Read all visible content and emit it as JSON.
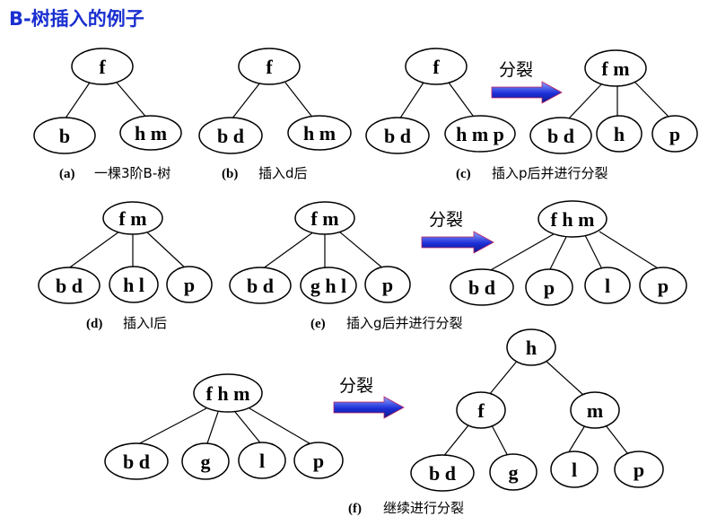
{
  "title": "B-树插入的例子",
  "arrow_label": "分裂",
  "colors": {
    "title": "#1a2fd0",
    "arrow_top": "#8fa0ff",
    "arrow_bottom": "#1c2fd6",
    "arrow_edge": "#c02060"
  },
  "captions": {
    "a": {
      "tag": "(a)",
      "text": "一棵3阶B-树"
    },
    "b": {
      "tag": "(b)",
      "text": "插入d后"
    },
    "c": {
      "tag": "(c)",
      "text": "插入p后并进行分裂"
    },
    "d": {
      "tag": "(d)",
      "text": "插入l后"
    },
    "e": {
      "tag": "(e)",
      "text": "插入g后并进行分裂"
    },
    "f": {
      "tag": "(f)",
      "text": "继续进行分裂"
    }
  },
  "nodes": {
    "a_f": "f",
    "a_b": "b",
    "a_hm": "h m",
    "b_f": "f",
    "b_bd": "b d",
    "b_hm": "h m",
    "c_f": "f",
    "c_bd": "b d",
    "c_hmp": "h m p",
    "c2_fm": "f m",
    "c2_bd": "b d",
    "c2_h": "h",
    "c2_p": "p",
    "d_fm": "f m",
    "d_bd": "b d",
    "d_hl": "h l",
    "d_p": "p",
    "e_fm": "f m",
    "e_bd": "b d",
    "e_ghl": "g h l",
    "e_p": "p",
    "e2_fhm": "f h m",
    "e2_bd": "b d",
    "e2_p": "p",
    "e2_l": "l",
    "e2_p2": "p",
    "f_fhm": "f h m",
    "f_bd": "b d",
    "f_g": "g",
    "f_l": "l",
    "f_p": "p",
    "f2_h": "h",
    "f2_f": "f",
    "f2_m": "m",
    "f2_bd": "b d",
    "f2_g": "g",
    "f2_l": "l",
    "f2_p": "p"
  }
}
